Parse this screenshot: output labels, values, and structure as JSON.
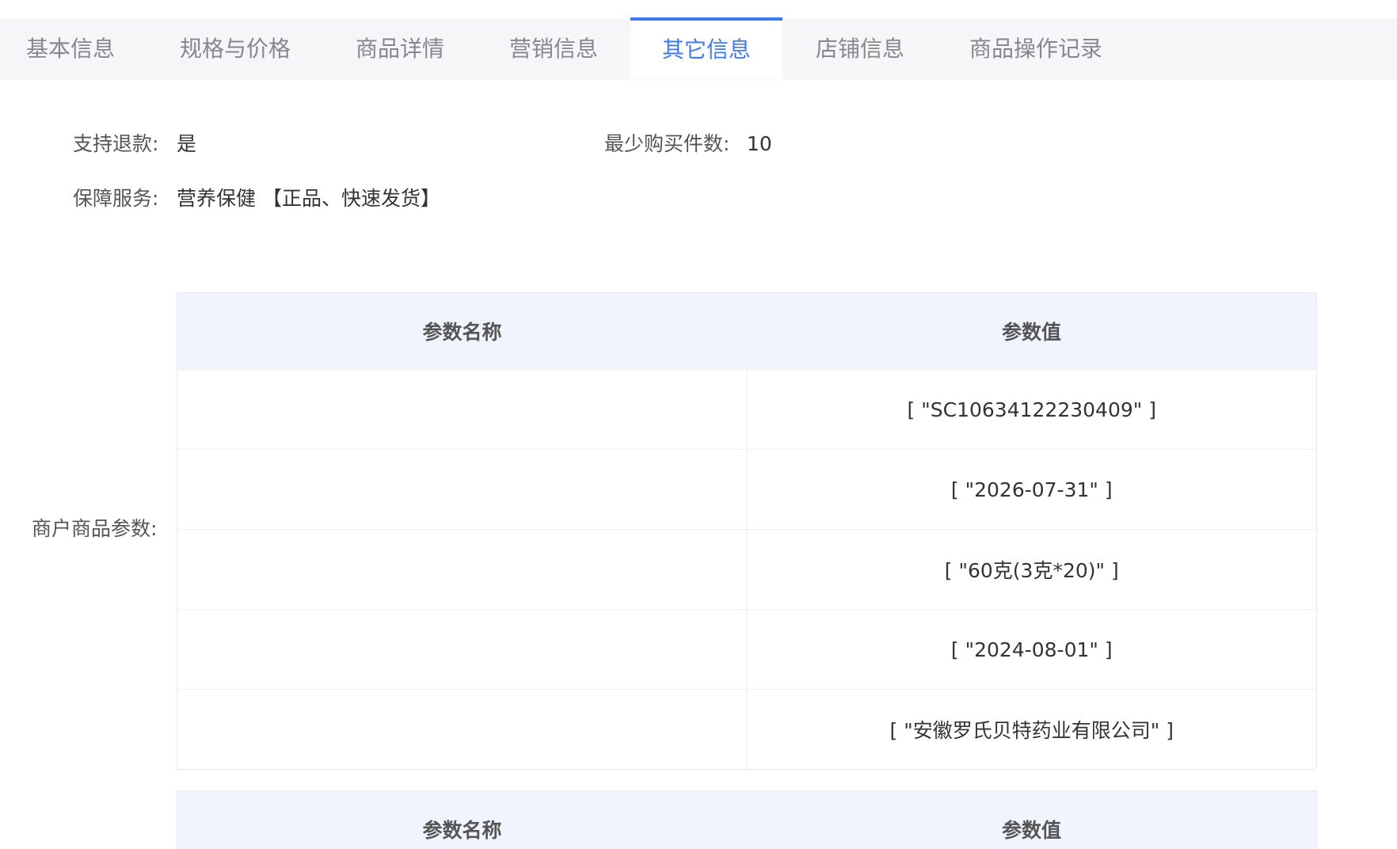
{
  "tabs": [
    {
      "label": "基本信息",
      "active": false
    },
    {
      "label": "规格与价格",
      "active": false
    },
    {
      "label": "商品详情",
      "active": false
    },
    {
      "label": "营销信息",
      "active": false
    },
    {
      "label": "其它信息",
      "active": true
    },
    {
      "label": "店铺信息",
      "active": false
    },
    {
      "label": "商品操作记录",
      "active": false
    }
  ],
  "info": {
    "refund_label": "支持退款:",
    "refund_value": "是",
    "min_qty_label": "最少购买件数:",
    "min_qty_value": "10",
    "guarantee_label": "保障服务:",
    "guarantee_value": "营养保健 【正品、快速发货】"
  },
  "merchant_params": {
    "label": "商户商品参数:",
    "table1": {
      "headers": [
        "参数名称",
        "参数值"
      ],
      "rows": [
        {
          "name": "",
          "value": "[ \"SC10634122230409\" ]"
        },
        {
          "name": "",
          "value": "[ \"2026-07-31\" ]"
        },
        {
          "name": "",
          "value": "[ \"60克(3克*20)\" ]"
        },
        {
          "name": "",
          "value": "[ \"2024-08-01\" ]"
        },
        {
          "name": "",
          "value": "[ \"安徽罗氏贝特药业有限公司\" ]"
        }
      ]
    },
    "table2": {
      "headers": [
        "参数名称",
        "参数值"
      ]
    }
  },
  "colors": {
    "accent": "#3e7bf2",
    "tab_bg": "#f5f6f8",
    "table_header_bg": "#f0f4fd"
  }
}
